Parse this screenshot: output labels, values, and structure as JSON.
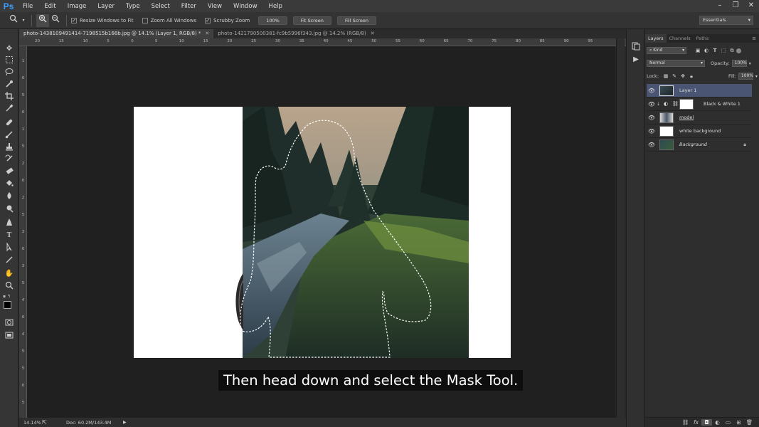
{
  "app": {
    "logo": "Ps"
  },
  "menu": [
    "File",
    "Edit",
    "Image",
    "Layer",
    "Type",
    "Select",
    "Filter",
    "View",
    "Window",
    "Help"
  ],
  "window_controls": {
    "minimize": "–",
    "restore": "❐",
    "close": "✕"
  },
  "options_bar": {
    "resize_windows": "Resize Windows to Fit",
    "zoom_all": "Zoom All Windows",
    "scrubby": "Scrubby Zoom",
    "percent_btn": "100%",
    "fit_btn": "Fit Screen",
    "fill_btn": "Fill Screen",
    "workspace": "Essentials"
  },
  "doc_tabs": [
    {
      "label": "photo-1438109491414-7198515b166b.jpg @ 14.1% (Layer 1, RGB/8) *",
      "close": "✕"
    },
    {
      "label": "photo-1421790500381-fc9b5996f343.jpg @ 14.2% (RGB/8)",
      "close": "✕"
    }
  ],
  "rulers": {
    "h": [
      "20",
      "15",
      "10",
      "5",
      "0",
      "5",
      "10",
      "15",
      "20",
      "25",
      "30",
      "35",
      "40",
      "45",
      "50",
      "55",
      "60",
      "65",
      "70",
      "75",
      "80",
      "85",
      "90",
      "95"
    ],
    "v": [
      "1",
      "0",
      "5",
      "0",
      "1",
      "5",
      "2",
      "0",
      "2",
      "5",
      "3",
      "0",
      "3",
      "5",
      "4",
      "0",
      "4",
      "5",
      "5",
      "0",
      "5"
    ]
  },
  "status": {
    "zoom": "14.14%",
    "doc": "Doc: 60.2M/143.4M"
  },
  "subtitle": "Then head down and select the Mask Tool.",
  "panel_tabs": [
    "Layers",
    "Channels",
    "Paths"
  ],
  "layers_panel": {
    "kind": "Kind",
    "blend_mode": "Normal",
    "opacity_label": "Opacity:",
    "opacity_value": "100%",
    "lock_label": "Lock:",
    "fill_label": "Fill:",
    "fill_value": "100%"
  },
  "layers": [
    {
      "name": "Layer 1",
      "selected": true
    },
    {
      "name": "Black & White 1",
      "selected": false
    },
    {
      "name": "model",
      "selected": false
    },
    {
      "name": "white background",
      "selected": false
    },
    {
      "name": "Background",
      "selected": false
    }
  ],
  "colors": {
    "app_bg": "#282828",
    "selection": "#4a5473",
    "ps_blue": "#3aa0ff"
  }
}
